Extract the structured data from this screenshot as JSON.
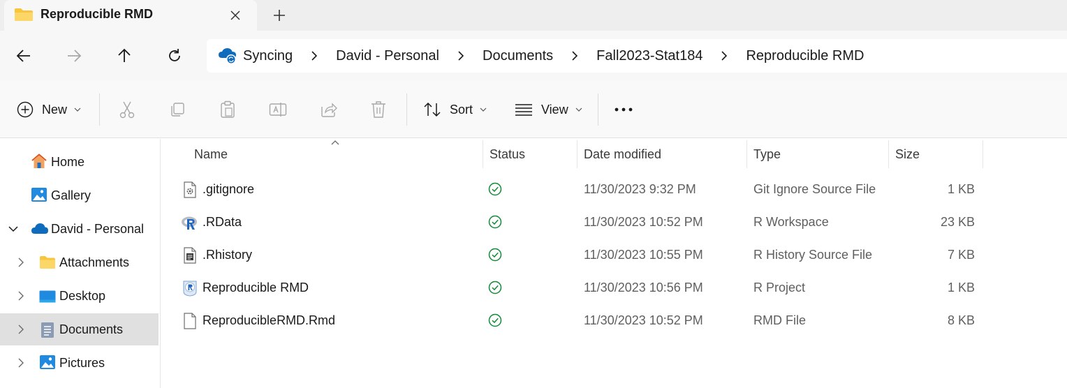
{
  "window": {
    "tab_title": "Reproducible RMD",
    "new_tab_glyph": "+",
    "close_glyph": "✕"
  },
  "breadcrumb": {
    "items": [
      "Syncing",
      "David - Personal",
      "Documents",
      "Fall2023-Stat184",
      "Reproducible RMD"
    ]
  },
  "toolbar": {
    "new_label": "New",
    "sort_label": "Sort",
    "view_label": "View",
    "more_glyph": "•••"
  },
  "sidebar": {
    "items": [
      {
        "label": "Home",
        "icon": "home-icon"
      },
      {
        "label": "Gallery",
        "icon": "gallery-icon"
      },
      {
        "label": "David - Personal",
        "icon": "onedrive-icon",
        "expanded": true
      },
      {
        "label": "Attachments",
        "icon": "folder-icon"
      },
      {
        "label": "Desktop",
        "icon": "desktop-icon"
      },
      {
        "label": "Documents",
        "icon": "documents-icon",
        "selected": true
      },
      {
        "label": "Pictures",
        "icon": "pictures-icon"
      }
    ]
  },
  "columns": {
    "name": "Name",
    "status": "Status",
    "date": "Date modified",
    "type": "Type",
    "size": "Size"
  },
  "files": [
    {
      "name": ".gitignore",
      "date": "11/30/2023 9:32 PM",
      "type": "Git Ignore Source File",
      "size": "1 KB",
      "icon": "settings-file-icon"
    },
    {
      "name": ".RData",
      "date": "11/30/2023 10:52 PM",
      "type": "R Workspace",
      "size": "23 KB",
      "icon": "r-workspace-icon"
    },
    {
      "name": ".Rhistory",
      "date": "11/30/2023 10:55 PM",
      "type": "R History Source File",
      "size": "7 KB",
      "icon": "text-file-icon"
    },
    {
      "name": "Reproducible RMD",
      "date": "11/30/2023 10:56 PM",
      "type": "R Project",
      "size": "1 KB",
      "icon": "r-project-icon"
    },
    {
      "name": "ReproducibleRMD.Rmd",
      "date": "11/30/2023 10:52 PM",
      "type": "RMD File",
      "size": "8 KB",
      "icon": "blank-file-icon"
    }
  ],
  "colors": {
    "accent": "#0067c0",
    "folder": "#f8c63d",
    "sync_green": "#138a36",
    "selected_bg": "#e0e0e0"
  }
}
